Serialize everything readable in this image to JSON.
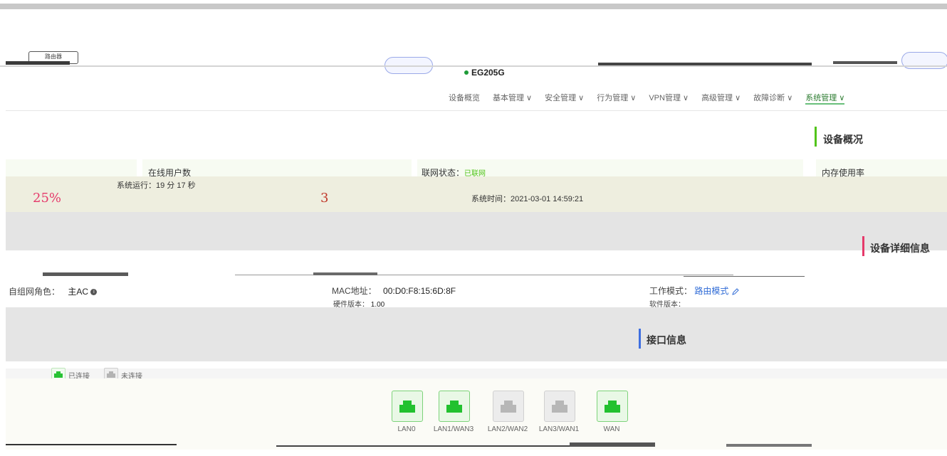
{
  "header": {
    "router_label": "路由器",
    "device_name": "EG205G"
  },
  "nav": {
    "items": [
      {
        "label": "设备概览"
      },
      {
        "label": "基本管理 ∨"
      },
      {
        "label": "安全管理 ∨"
      },
      {
        "label": "行为管理 ∨"
      },
      {
        "label": "VPN管理 ∨"
      },
      {
        "label": "高级管理 ∨"
      },
      {
        "label": "故障诊断 ∨"
      },
      {
        "label": "系统管理 ∨"
      }
    ]
  },
  "overview": {
    "title": "设备概况",
    "cpu_value": "25%",
    "uptime_label": "系统运行：",
    "uptime_value": "19 分 17 秒",
    "online_users_label": "在线用户数",
    "online_users_value": "3",
    "network_status_label": "联网状态：",
    "network_status_value": "已联网",
    "system_time_label": "系统时间：",
    "system_time_value": "2021-03-01 14:59:21",
    "memory_label": "内存使用率"
  },
  "detail": {
    "title": "设备详细信息",
    "role_label": "自组网角色：",
    "role_value": "主AC",
    "mac_label": "MAC地址：",
    "mac_value": "00:D0:F8:15:6D:8F",
    "hw_version_label": "硬件版本：",
    "hw_version_value": "1.00",
    "work_mode_label": "工作模式：",
    "work_mode_value": "路由模式",
    "sw_version_label": "软件版本："
  },
  "interfaces": {
    "title": "接口信息",
    "legend_connected": "已连接",
    "legend_disconnected": "未连接",
    "ports": [
      {
        "label": "LAN0",
        "status": "connected"
      },
      {
        "label": "LAN1/WAN3",
        "status": "connected"
      },
      {
        "label": "LAN2/WAN2",
        "status": "disconnected"
      },
      {
        "label": "LAN3/WAN1",
        "status": "disconnected"
      },
      {
        "label": "WAN",
        "status": "connected"
      }
    ]
  },
  "colors": {
    "accent_green": "#2fbf3a",
    "accent_blue": "#3f6fe0",
    "accent_red": "#e5396a",
    "link_blue": "#2f6bd6"
  }
}
